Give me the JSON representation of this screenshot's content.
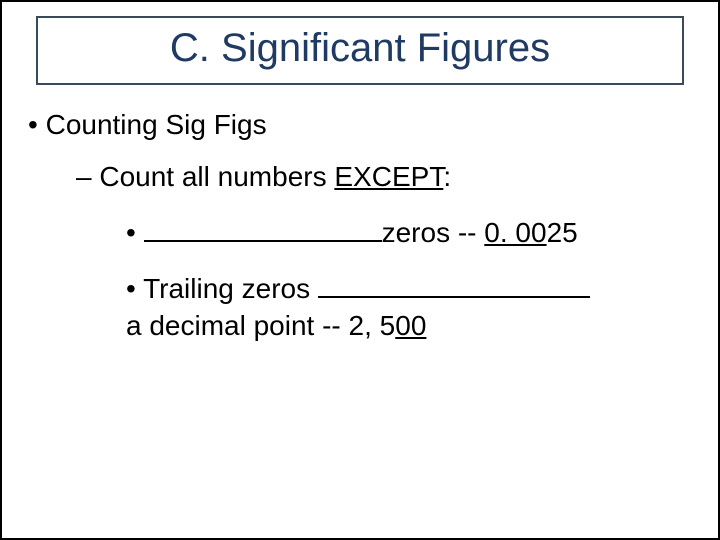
{
  "title": "C. Significant Figures",
  "l1": "Counting Sig Figs",
  "l2_pre": "Count all numbers ",
  "l2_except": "EXCEPT",
  "l2_post": ":",
  "l3a_zeros": "zeros -- ",
  "l3a_ex_u": "0. 00",
  "l3a_ex_tail": "25",
  "l3b_pre": "Trailing zeros ",
  "l3b_line2_pre": "a decimal point -- 2, 5",
  "l3b_line2_u": "00"
}
